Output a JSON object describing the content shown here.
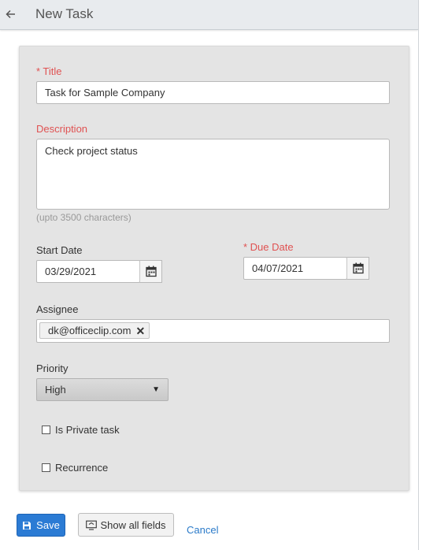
{
  "header": {
    "title": "New Task"
  },
  "form": {
    "title_label": "* Title",
    "title_value": "Task for Sample Company",
    "description_label": "Description",
    "description_value": "Check project status",
    "description_hint": "(upto 3500 characters)",
    "start_date_label": "Start Date",
    "start_date_value": "03/29/2021",
    "due_date_label": "* Due Date",
    "due_date_value": "04/07/2021",
    "assignee_label": "Assignee",
    "assignee_chip": "dk@officeclip.com",
    "priority_label": "Priority",
    "priority_value": "High",
    "private_label": "Is Private task",
    "private_checked": false,
    "recurrence_label": "Recurrence",
    "recurrence_checked": false
  },
  "actions": {
    "save_label": "Save",
    "show_all_label": "Show all fields",
    "cancel_label": "Cancel"
  },
  "colors": {
    "required_label": "#e05252",
    "primary_button": "#2b7bd4",
    "link": "#2a7ac9"
  }
}
